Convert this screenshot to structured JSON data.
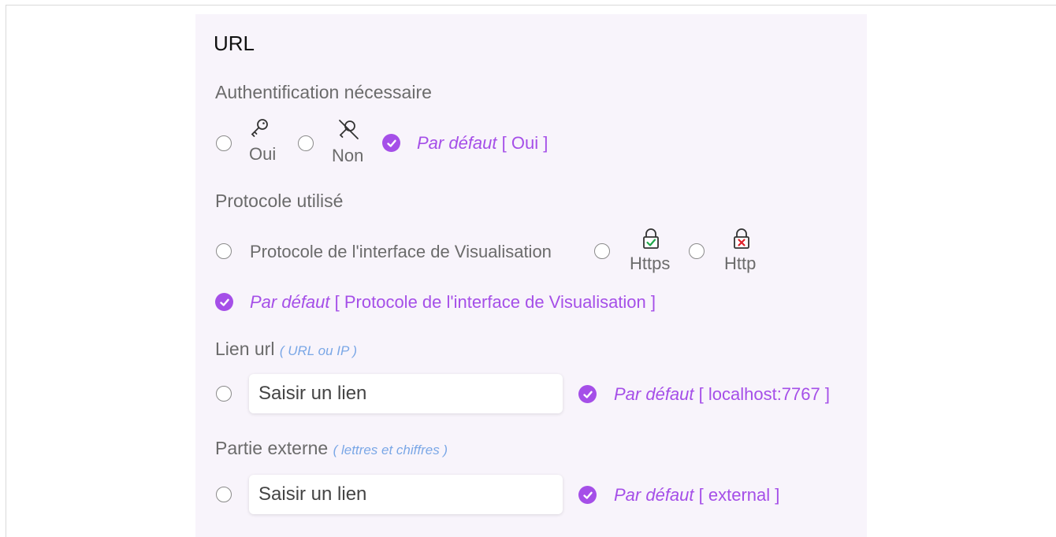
{
  "section": {
    "title": "URL"
  },
  "auth": {
    "label": "Authentification nécessaire",
    "options": [
      {
        "icon": "key-icon",
        "label": "Oui"
      },
      {
        "icon": "no-key-icon",
        "label": "Non"
      }
    ],
    "default_prefix": "Par défaut",
    "default_value": "[ Oui ]"
  },
  "protocol": {
    "label": "Protocole utilisé",
    "options": [
      {
        "label": "Protocole de l'interface de Visualisation"
      },
      {
        "icon": "lock-check-icon",
        "label": "Https"
      },
      {
        "icon": "lock-cross-icon",
        "label": "Http"
      }
    ],
    "default_prefix": "Par défaut",
    "default_value": "[ Protocole de l'interface de Visualisation ]"
  },
  "url_link": {
    "label": "Lien url",
    "hint": "( URL ou IP )",
    "placeholder": "Saisir un lien",
    "default_prefix": "Par défaut",
    "default_value": "[ localhost:7767 ]"
  },
  "external_part": {
    "label": "Partie externe",
    "hint": "( lettres et chiffres )",
    "placeholder": "Saisir un lien",
    "default_prefix": "Par défaut",
    "default_value": "[ external ]"
  },
  "colors": {
    "accent": "#a54fe8",
    "panel": "#f8f4fb",
    "hint": "#7aa7e6"
  }
}
